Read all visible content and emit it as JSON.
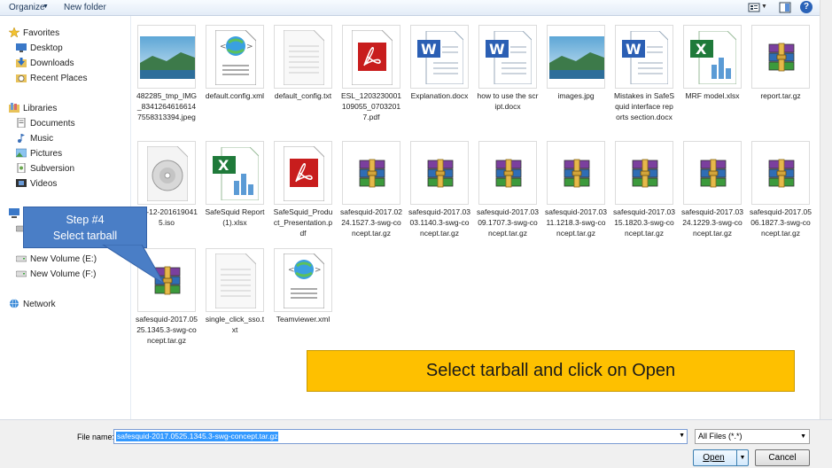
{
  "toolbar": {
    "organize": "Organize",
    "new_folder": "New folder",
    "help": "?"
  },
  "nav": {
    "favorites": "Favorites",
    "desktop": "Desktop",
    "downloads": "Downloads",
    "recent_places": "Recent Places",
    "libraries": "Libraries",
    "documents": "Documents",
    "music": "Music",
    "pictures": "Pictures",
    "subversion": "Subversion",
    "videos": "Videos",
    "volume_e": "New Volume (E:)",
    "volume_f": "New Volume (F:)",
    "network": "Network"
  },
  "files": [
    {
      "name": "482285_tmp_IMG_83412646166147558313394.jpeg",
      "type": "image"
    },
    {
      "name": "default.config.xml",
      "type": "xml"
    },
    {
      "name": "default_config.txt",
      "type": "txt"
    },
    {
      "name": "ESL_1203230001109055_07032017.pdf",
      "type": "pdf"
    },
    {
      "name": "Explanation.docx",
      "type": "docx"
    },
    {
      "name": "how to use the script.docx",
      "type": "docx"
    },
    {
      "name": "images.jpg",
      "type": "image"
    },
    {
      "name": "Mistakes in SafeSquid interface reports section.docx",
      "type": "docx"
    },
    {
      "name": "MRF model.xlsx",
      "type": "xlsx"
    },
    {
      "name": "report.tar.gz",
      "type": "rar"
    },
    {
      "name": "-16-12-2016190415.iso",
      "type": "iso"
    },
    {
      "name": "SafeSquid Report(1).xlsx",
      "type": "xlsx"
    },
    {
      "name": "SafeSquid_Product_Presentation.pdf",
      "type": "pdf"
    },
    {
      "name": "safesquid-2017.0224.1527.3-swg-concept.tar.gz",
      "type": "rar"
    },
    {
      "name": "safesquid-2017.0303.1140.3-swg-concept.tar.gz",
      "type": "rar"
    },
    {
      "name": "safesquid-2017.0309.1707.3-swg-concept.tar.gz",
      "type": "rar"
    },
    {
      "name": "safesquid-2017.0311.1218.3-swg-concept.tar.gz",
      "type": "rar"
    },
    {
      "name": "safesquid-2017.0315.1820.3-swg-concept.tar.gz",
      "type": "rar"
    },
    {
      "name": "safesquid-2017.0324.1229.3-swg-concept.tar.gz",
      "type": "rar"
    },
    {
      "name": "safesquid-2017.0506.1827.3-swg-concept.tar.gz",
      "type": "rar"
    },
    {
      "name": "safesquid-2017.0525.1345.3-swg-concept.tar.gz",
      "type": "rar"
    },
    {
      "name": "single_click_sso.txt",
      "type": "txt"
    },
    {
      "name": "Teamviewer.xml",
      "type": "xml"
    }
  ],
  "bottom": {
    "file_name_label": "File name:",
    "file_name_value": "safesquid-2017.0525.1345.3-swg-concept.tar.gz",
    "filter": "All Files (*.*)",
    "open": "Open",
    "cancel": "Cancel"
  },
  "callouts": {
    "step_line1": "Step #4",
    "step_line2": "Select tarball",
    "banner": "Select tarball and click on Open"
  },
  "colors": {
    "callout_blue": "#4a7ec6",
    "banner_yellow": "#fec000",
    "selection_blue": "#3399ff"
  }
}
